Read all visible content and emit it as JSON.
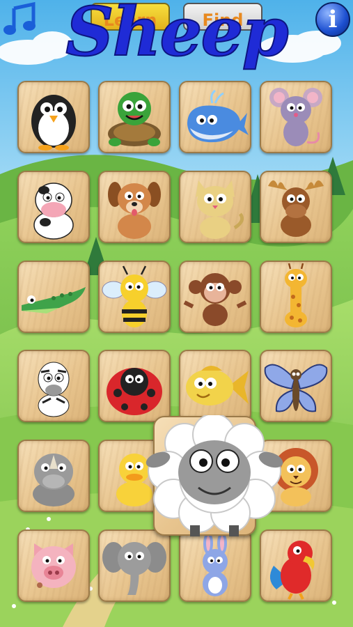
{
  "header": {
    "learn_label": "Learn",
    "find_label": "Find",
    "current_animal": "Sheep"
  },
  "icons": {
    "music": "music-note-icon",
    "info": "info-icon",
    "info_glyph": "i"
  },
  "animals": [
    "Penguin",
    "Turtle",
    "Whale",
    "Mouse",
    "Cow",
    "Dog",
    "Cat",
    "Moose",
    "Crocodile",
    "Bee",
    "Monkey",
    "Giraffe",
    "Zebra",
    "Ladybug",
    "Fish",
    "Butterfly",
    "Rhino",
    "Duck",
    "Sheep",
    "Lion",
    "Pig",
    "Elephant",
    "Rabbit",
    "Parrot"
  ],
  "colors": {
    "title": "#1f2bd6",
    "sky": "#9fd3f0",
    "grass": "#7cc24a",
    "tile": "#e8c58f"
  }
}
